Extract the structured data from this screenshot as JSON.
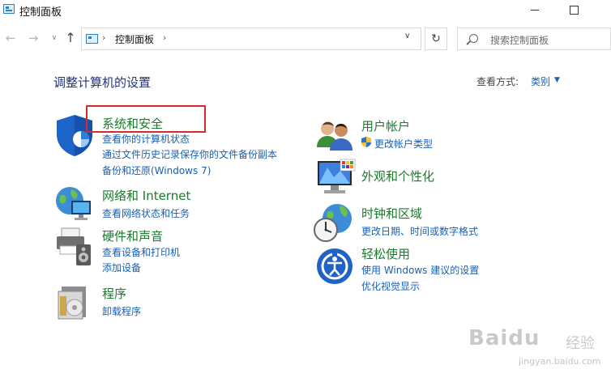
{
  "window": {
    "title": "控制面板"
  },
  "nav": {
    "back_icon": "arrow-left-icon",
    "forward_icon": "arrow-right-icon",
    "up_icon": "arrow-up-icon",
    "address": {
      "path": "控制面板"
    },
    "search": {
      "placeholder": "搜索控制面板"
    }
  },
  "main": {
    "heading": "调整计算机的设置",
    "view_by": {
      "label": "查看方式:",
      "value": "类别"
    },
    "categories_left": [
      {
        "icon": "shield-icon",
        "title": "系统和安全",
        "links": [
          "查看你的计算机状态",
          "通过文件历史记录保存你的文件备份副本",
          "备份和还原(Windows 7)"
        ]
      },
      {
        "icon": "network-icon",
        "title": "网络和 Internet",
        "links": [
          "查看网络状态和任务"
        ]
      },
      {
        "icon": "printer-icon",
        "title": "硬件和声音",
        "links": [
          "查看设备和打印机",
          "添加设备"
        ]
      },
      {
        "icon": "programs-icon",
        "title": "程序",
        "links": [
          "卸载程序"
        ]
      }
    ],
    "categories_right": [
      {
        "icon": "users-icon",
        "title": "用户帐户",
        "links": [
          "更改帐户类型"
        ]
      },
      {
        "icon": "display-icon",
        "title": "外观和个性化",
        "links": []
      },
      {
        "icon": "clock-globe-icon",
        "title": "时钟和区域",
        "links": [
          "更改日期、时间或数字格式"
        ]
      },
      {
        "icon": "accessibility-icon",
        "title": "轻松使用",
        "links": [
          "使用 Windows 建议的设置",
          "优化视觉显示"
        ]
      }
    ]
  },
  "watermark": {
    "logo": "Baidu",
    "text": "经验",
    "url": "jingyan.baidu.com"
  }
}
